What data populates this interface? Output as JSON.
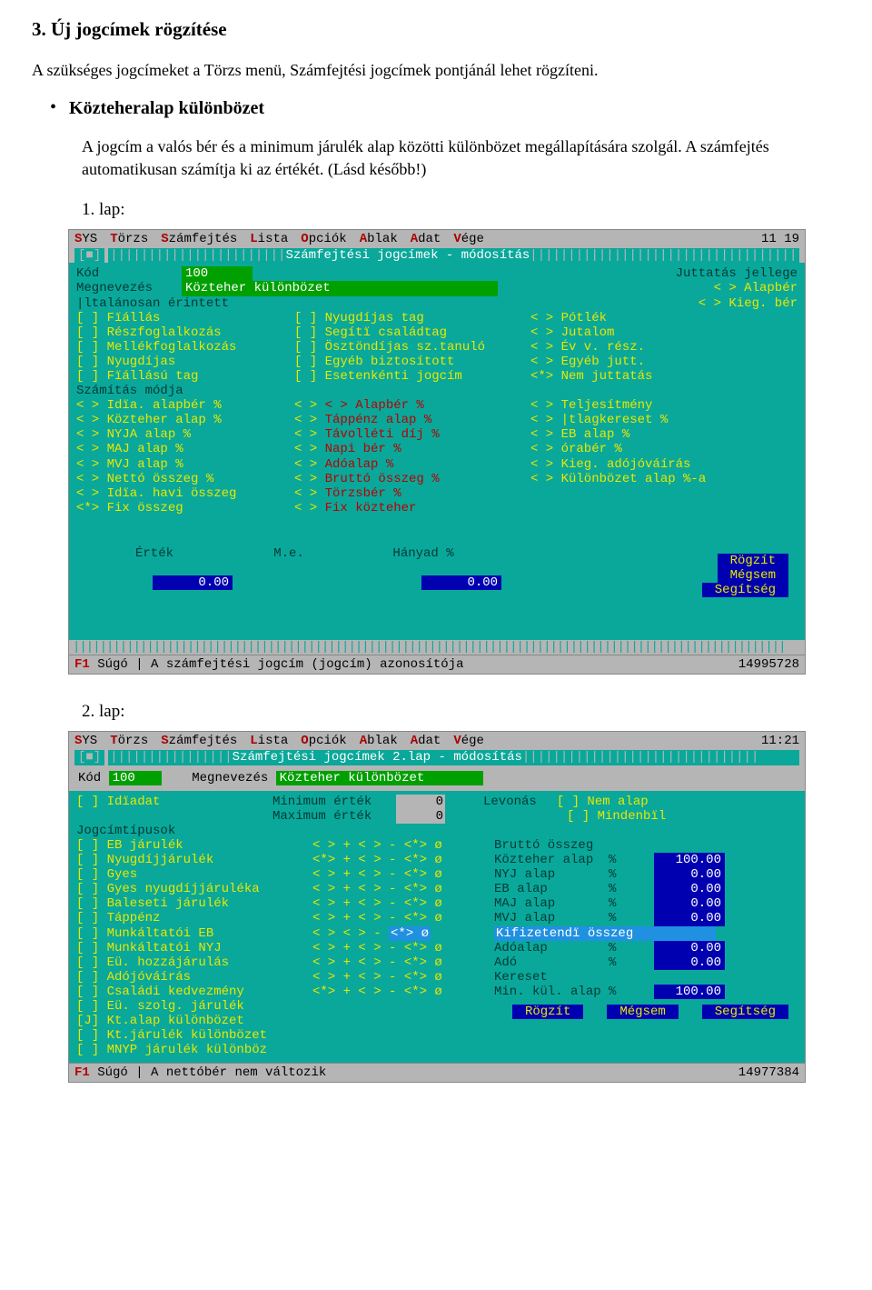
{
  "doc": {
    "heading": "3. Új jogcímek rögzítése",
    "intro": "A szükséges jogcímeket a Törzs menü, Számfejtési jogcímek pontjánál lehet rögzíteni.",
    "bullet_label": "Közteheralap különbözet",
    "bullet_desc": "A jogcím a valós bér és a minimum járulék alap közötti különbözet megállapítására szolgál. A számfejtés automatikusan számítja ki az értékét. (Lásd később!)",
    "lap1": "1. lap:",
    "lap2": "2. lap:"
  },
  "screen1": {
    "menubar": [
      "SYS",
      "Törzs",
      "Számfejtés",
      "Lista",
      "Opciók",
      "Ablak",
      "Adat",
      "Vége"
    ],
    "time": "11 19",
    "title": "Számfejtési jogcímek - módosítás",
    "kod_label": "Kód",
    "kod_value": "100",
    "megnevezes_label": "Megnevezés",
    "megnevezes_value": "Közteher különbözet",
    "juttatas_label": "Juttatás jellege",
    "altalanos": "|ltalánosan érintett",
    "altalanos_items_c1": [
      "[ ] Fïállás",
      "[ ] Részfoglalkozás",
      "[ ] Mellékfoglalkozás",
      "[ ] Nyugdíjas",
      "[ ] Fïállású tag"
    ],
    "altalanos_items_c2": [
      "[ ] Nyugdíjas tag",
      "[ ] Segítï családtag",
      "[ ] Ösztöndíjas sz.tanuló",
      "[ ] Egyéb biztosított",
      "[ ] Esetenkénti jogcím"
    ],
    "juttatas_items": [
      "< > Alapbér",
      "< > Kieg. bér",
      "< > Pótlék",
      "< > Jutalom",
      "< > Év v. rész.",
      "< > Egyéb jutt.",
      "<*> Nem juttatás"
    ],
    "szamitas_label": "Számítás módja",
    "szamitas_c1": [
      "< > Idïa. alapbér %",
      "< > Közteher alap %",
      "< > NYJA alap %",
      "< > MAJ alap %",
      "< > MVJ alap %",
      "< > Nettó összeg %",
      "< > Idïa. havi összeg",
      "<*> Fix összeg"
    ],
    "szamitas_c2": [
      "< > Alapbér %",
      "< > Táppénz alap %",
      "< > Távolléti díj %",
      "< > Napi bér %",
      "< > Adóalap %",
      "< > Bruttó összeg %",
      "< > Törzsbér %",
      "< > Fix közteher"
    ],
    "szamitas_c3": [
      "< > Teljesítmény",
      "< > |tlagkereset %",
      "< > EB alap %",
      "< > órabér %",
      "< > Kieg. adójóváírás",
      "< > Különbözet alap %-a"
    ],
    "bottom_labels": [
      "Érték",
      "M.e.",
      "Hányad %"
    ],
    "bottom_values": [
      "0.00",
      "",
      "0.00"
    ],
    "buttons": [
      "Rögzít",
      "Mégsem",
      "Segítség"
    ],
    "footer_f1": "F1",
    "footer_text": "Súgó | A számfejtési jogcím (jogcím) azonosítója",
    "footer_num": "14995728"
  },
  "screen2": {
    "menubar": [
      "SYS",
      "Törzs",
      "Számfejtés",
      "Lista",
      "Opciók",
      "Ablak",
      "Adat",
      "Vége"
    ],
    "time": "11:21",
    "title": "Számfejtési jogcímek 2.lap - módosítás",
    "kod_label": "Kód",
    "kod_value": "100",
    "megnevezes_label": "Megnevezés",
    "megnevezes_value": "Közteher különbözet",
    "idoadat": "[ ] Idïadat",
    "min_label": "Minimum érték",
    "min_value": "0",
    "max_label": "Maximum érték",
    "max_value": "0",
    "levonas_label": "Levonás",
    "levonas_items": [
      "[ ] Nem alap",
      "[ ] Mindenbïl"
    ],
    "jogcim_label": "Jogcímtípusok",
    "jogcim_items": [
      "[ ] EB járulék",
      "[ ] Nyugdíjjárulék",
      "[ ] Gyes",
      "[ ] Gyes nyugdíjjáruléka",
      "[ ] Baleseti járulék",
      "[ ] Táppénz",
      "[ ] Munkáltatói EB",
      "[ ] Munkáltatói NYJ",
      "[ ] Eü. hozzájárulás",
      "[ ] Adójóváírás",
      "[ ] Családi kedvezmény",
      "[ ] Eü. szolg. járulék",
      "[J] Kt.alap különbözet",
      "[ ] Kt.járulék különbözet",
      "[ ] MNYP járulék különböz"
    ],
    "ops_rows": [
      "< > +  < > -  <*> ø",
      "<*> +  < > -  <*> ø",
      "< > +  < > -  <*> ø",
      "< > +  < > -  <*> ø",
      "< > +  < > -  <*> ø",
      "< > +  < > -  <*> ø",
      "< >    < > -  <*> ø",
      "< > +  < > -  <*> ø",
      "< > +  < > -  <*> ø",
      "< > +  < > -  <*> ø",
      "<*> +  < > -  <*> ø"
    ],
    "right_labels": [
      "Bruttó összeg",
      "Közteher alap  %",
      "NYJ alap       %",
      "EB alap        %",
      "MAJ alap       %",
      "MVJ alap       %",
      "Kifizetendï összeg",
      "Adóalap        %",
      "Adó            %",
      "Kereset",
      "Min. kül. alap %"
    ],
    "right_values": [
      "",
      "100.00",
      "0.00",
      "0.00",
      "0.00",
      "0.00",
      "",
      "0.00",
      "0.00",
      "",
      "100.00"
    ],
    "buttons": [
      "Rögzít",
      "Mégsem",
      "Segítség"
    ],
    "footer_f1": "F1",
    "footer_text": "Súgó | A nettóbér nem változik",
    "footer_num": "14977384"
  }
}
